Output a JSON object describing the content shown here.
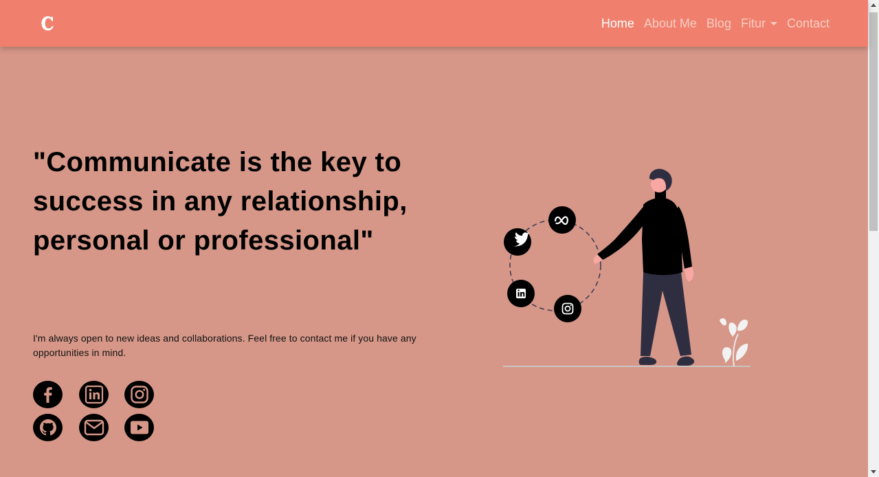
{
  "navbar": {
    "brand": "C",
    "links": [
      {
        "label": "Home",
        "active": true
      },
      {
        "label": "About Me"
      },
      {
        "label": "Blog"
      },
      {
        "label": "Fitur",
        "dropdown": true
      },
      {
        "label": "Contact"
      }
    ]
  },
  "hero": {
    "quote": "\"Communicate is the key to success in any relationship, personal or professional\"",
    "text": "I'm always open to new ideas and collaborations. Feel free to contact me if you have any opportunities in mind."
  },
  "socials": [
    "facebook-icon",
    "linkedin-icon",
    "instagram-icon",
    "github-icon",
    "mail-icon",
    "youtube-icon"
  ],
  "illustration_icons": [
    "meta-icon",
    "twitter-icon",
    "linkedin-icon",
    "instagram-icon"
  ],
  "colors": {
    "navbar": "#f0806d",
    "background": "#d69788",
    "text": "#000000"
  }
}
